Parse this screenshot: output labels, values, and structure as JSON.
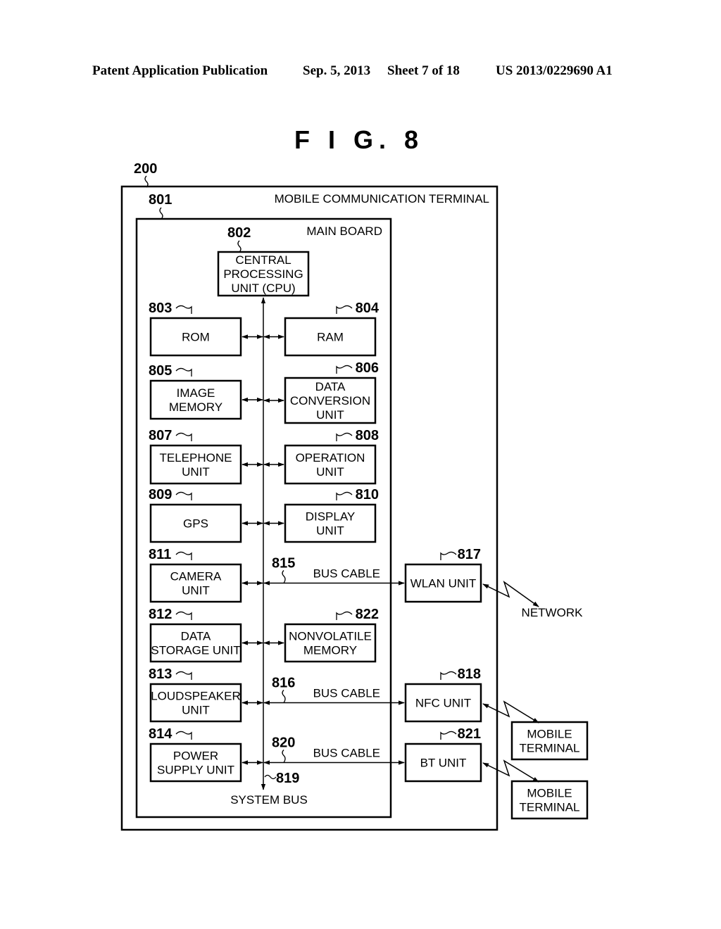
{
  "header": {
    "publication": "Patent Application Publication",
    "date": "Sep. 5, 2013",
    "sheet": "Sheet 7 of 18",
    "number": "US 2013/0229690 A1"
  },
  "figure": {
    "title": "F I G. 8",
    "terminal": {
      "ref": "200",
      "label": "MOBILE COMMUNICATION TERMINAL"
    },
    "main_board": {
      "ref": "801",
      "label": "MAIN BOARD"
    },
    "cpu": {
      "ref": "802",
      "lines": [
        "CENTRAL",
        "PROCESSING",
        "UNIT (CPU)"
      ]
    },
    "left_blocks": [
      {
        "ref": "803",
        "lines": [
          "ROM"
        ]
      },
      {
        "ref": "805",
        "lines": [
          "IMAGE",
          "MEMORY"
        ]
      },
      {
        "ref": "807",
        "lines": [
          "TELEPHONE",
          "UNIT"
        ]
      },
      {
        "ref": "809",
        "lines": [
          "GPS"
        ]
      },
      {
        "ref": "811",
        "lines": [
          "CAMERA",
          "UNIT"
        ]
      },
      {
        "ref": "812",
        "lines": [
          "DATA",
          "STORAGE UNIT"
        ]
      },
      {
        "ref": "813",
        "lines": [
          "LOUDSPEAKER",
          "UNIT"
        ]
      },
      {
        "ref": "814",
        "lines": [
          "POWER",
          "SUPPLY UNIT"
        ]
      }
    ],
    "right_blocks": [
      {
        "ref": "804",
        "lines": [
          "RAM"
        ]
      },
      {
        "ref": "806",
        "lines": [
          "DATA",
          "CONVERSION",
          "UNIT"
        ]
      },
      {
        "ref": "808",
        "lines": [
          "OPERATION",
          "UNIT"
        ]
      },
      {
        "ref": "810",
        "lines": [
          "DISPLAY",
          "UNIT"
        ]
      },
      {
        "ref": "822",
        "lines": [
          "NONVOLATILE",
          "MEMORY"
        ]
      }
    ],
    "bus_cables": [
      {
        "ref": "815",
        "label": "BUS CABLE"
      },
      {
        "ref": "816",
        "label": "BUS CABLE"
      },
      {
        "ref": "820",
        "label": "BUS CABLE"
      }
    ],
    "external_units": [
      {
        "ref": "817",
        "lines": [
          "WLAN UNIT"
        ]
      },
      {
        "ref": "818",
        "lines": [
          "NFC UNIT"
        ]
      },
      {
        "ref": "821",
        "lines": [
          "BT UNIT"
        ]
      }
    ],
    "system_bus": {
      "ref": "819",
      "label": "SYSTEM BUS"
    },
    "network_label": "NETWORK",
    "mobile_terminals": [
      {
        "lines": [
          "MOBILE",
          "TERMINAL"
        ]
      },
      {
        "lines": [
          "MOBILE",
          "TERMINAL"
        ]
      }
    ]
  }
}
